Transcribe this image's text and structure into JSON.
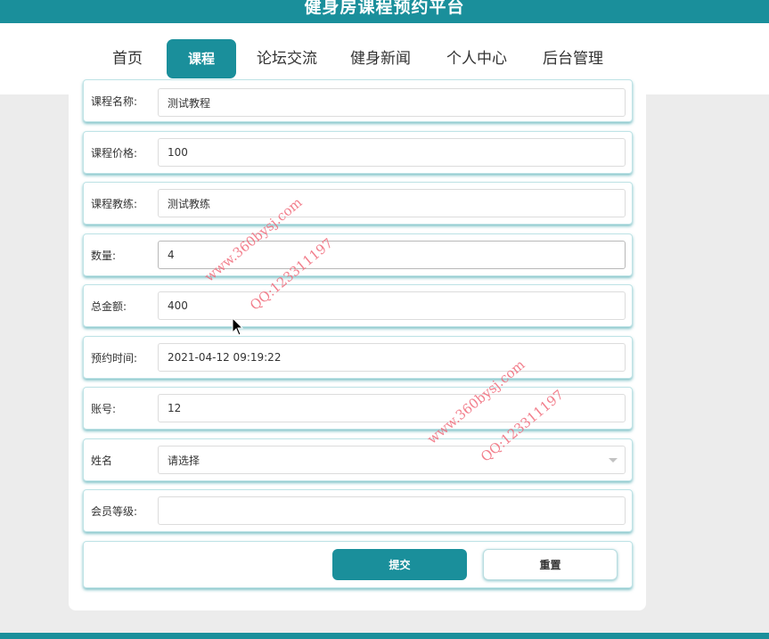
{
  "header": {
    "site_title": "健身房课程预约平台"
  },
  "nav": {
    "items": [
      "首页",
      "课程",
      "论坛交流",
      "健身新闻",
      "个人中心",
      "后台管理"
    ],
    "active": "课程"
  },
  "form": {
    "course_name": {
      "label": "课程名称:",
      "value": "测试教程"
    },
    "course_price": {
      "label": "课程价格:",
      "value": "100"
    },
    "course_coach": {
      "label": "课程教练:",
      "value": "测试教练"
    },
    "quantity": {
      "label": "数量:",
      "value": "4"
    },
    "total_amount": {
      "label": "总金额:",
      "value": "400"
    },
    "booking_time": {
      "label": "预约时间:",
      "value": "2021-04-12 09:19:22"
    },
    "account": {
      "label": "账号:",
      "value": "12"
    },
    "name": {
      "label": "姓名",
      "placeholder": "请选择"
    },
    "member_level": {
      "label": "会员等级:",
      "value": ""
    },
    "submit_label": "提交",
    "reset_label": "重置"
  },
  "watermarks": {
    "site": "www.360bysj.com",
    "qq": "QQ:123311197"
  },
  "colors": {
    "accent": "#1a8f9b",
    "watermark": "#f06a7a"
  }
}
